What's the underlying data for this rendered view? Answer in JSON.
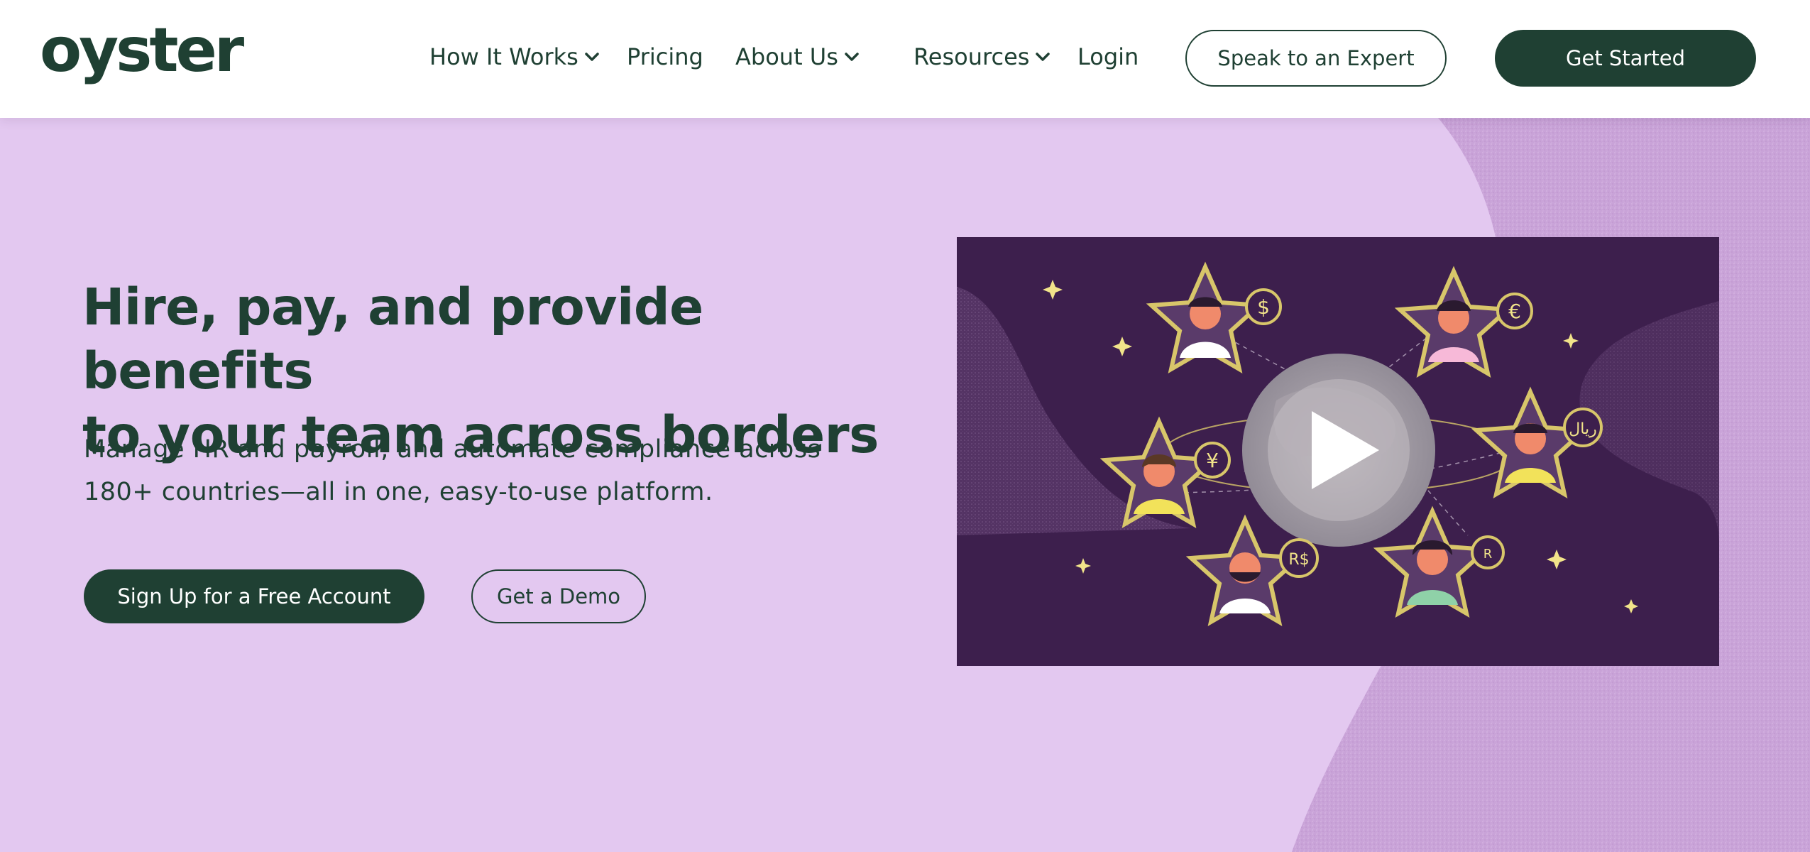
{
  "brand": {
    "logo_text": "oyster",
    "primary": "#1f4033",
    "hero_bg": "#e3c8f0",
    "video_bg": "#3d1f4d",
    "accent_gold": "#d8c66a"
  },
  "nav": {
    "items": [
      {
        "label": "How It Works",
        "has_dropdown": true
      },
      {
        "label": "Pricing",
        "has_dropdown": false
      },
      {
        "label": "About Us",
        "has_dropdown": true
      },
      {
        "label": "Resources",
        "has_dropdown": true
      },
      {
        "label": "Login",
        "has_dropdown": false
      }
    ],
    "speak_label": "Speak to an Expert",
    "get_started_label": "Get Started"
  },
  "hero": {
    "title_line1": "Hire, pay, and provide benefits",
    "title_line2": "to your team across borders",
    "sub_line1": "Manage HR and payroll, and automate compliance across",
    "sub_line2": "180+ countries—all in one, easy-to-use platform.",
    "primary_cta": "Sign Up for a Free Account",
    "secondary_cta": "Get a Demo"
  },
  "video": {
    "currencies": [
      "$",
      "€",
      "¥",
      "ريال",
      "R$",
      "R"
    ],
    "play_icon": "play-icon"
  }
}
